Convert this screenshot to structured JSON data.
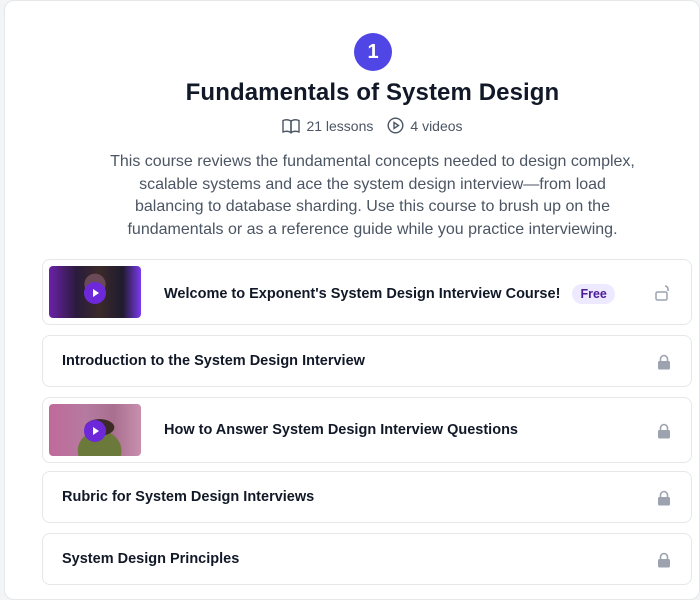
{
  "course": {
    "step": "1",
    "title": "Fundamentals of System Design",
    "lessons_count": "21 lessons",
    "videos_count": "4 videos",
    "description": "This course reviews the fundamental concepts needed to design complex, scalable systems and ace the system design interview—from load balancing to database sharding. Use this course to brush up on the fundamentals or as a reference guide while you practice interviewing."
  },
  "lessons": [
    {
      "title": "Welcome to Exponent's System Design Interview Course!",
      "badge": "Free",
      "locked": false,
      "has_video": true
    },
    {
      "title": "Introduction to the System Design Interview",
      "locked": true,
      "has_video": false
    },
    {
      "title": "How to Answer System Design Interview Questions",
      "locked": true,
      "has_video": true
    },
    {
      "title": "Rubric for System Design Interviews",
      "locked": true,
      "has_video": false
    },
    {
      "title": "System Design Principles",
      "locked": true,
      "has_video": false
    }
  ],
  "colors": {
    "accent": "#4f46e5",
    "badge_bg": "#ede9fe",
    "lock": "#9ca3af"
  },
  "icons": {
    "lessons": "book-open-icon",
    "videos": "play-circle-icon",
    "locked": "lock-icon",
    "unlocked": "unlock-icon",
    "play": "play-icon"
  }
}
